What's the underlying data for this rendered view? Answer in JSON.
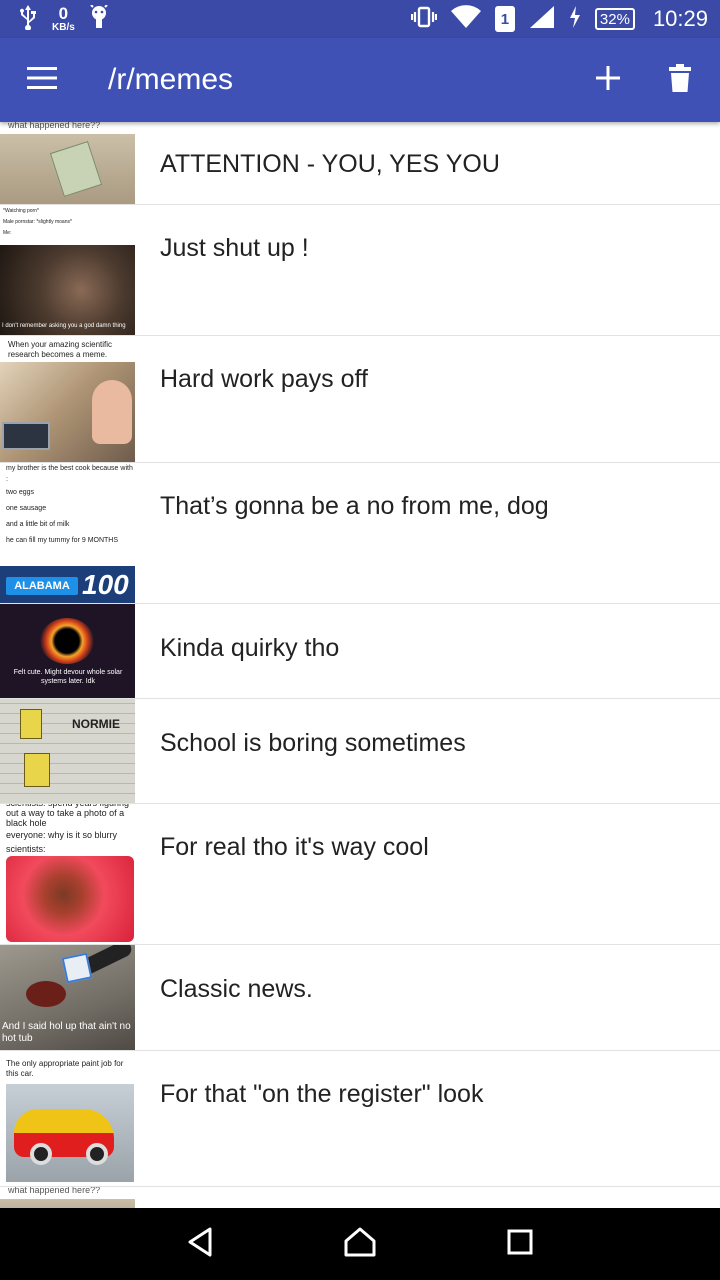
{
  "status_bar": {
    "network_speed_value": "0",
    "network_speed_unit": "KB/s",
    "sim_slot": "1",
    "battery_percent": "32%",
    "time": "10:29"
  },
  "app_bar": {
    "title": "/r/memes"
  },
  "posts": [
    {
      "title": "ATTENTION - YOU, YES YOU",
      "thumb_caption": "what happened here??",
      "thumb_colors": [
        "#c9bfae",
        "#a89a82"
      ]
    },
    {
      "title": "Just shut up !",
      "thumb_caption": "I don't remember asking you a god damn thing",
      "thumb_top_lines": [
        "*Watching porn*",
        "Male pornstar: *slightly moans*",
        "Me:"
      ],
      "thumb_colors": [
        "#5a4a3e",
        "#2a2018"
      ]
    },
    {
      "title": "Hard work pays off",
      "thumb_caption": "When your amazing scientific research becomes a meme.",
      "thumb_colors": [
        "#d8c6a8",
        "#6a5444"
      ]
    },
    {
      "title": "That’s gonna be a no from me, dog",
      "thumb_top_lines": [
        "my brother is the best cook because with :",
        "two eggs",
        "one sausage",
        "and a little bit of milk",
        "he can fill my tummy for 9 MONTHS"
      ],
      "thumb_badge": "ALABAMA",
      "thumb_score": "100",
      "thumb_colors": [
        "#ffffff",
        "#ffffff"
      ]
    },
    {
      "title": "Kinda quirky tho",
      "thumb_caption": "Felt cute. Might devour whole solar systems later. Idk",
      "thumb_colors": [
        "#2a1d33",
        "#140c1c"
      ]
    },
    {
      "title": "School is boring sometimes",
      "thumb_caption": "NORMIE",
      "thumb_colors": [
        "#d6d6cf",
        "#b9b9b0"
      ]
    },
    {
      "title": "For real tho it's way cool",
      "thumb_top_lines": [
        "scientists: spend years figuring out a way to take a photo of a black hole",
        "everyone: why is it so blurry",
        "scientists:"
      ],
      "thumb_colors": [
        "#f14a5c",
        "#c21a2a"
      ]
    },
    {
      "title": "Classic news.",
      "thumb_caption": "And I said hol up that ain't no hot tub",
      "thumb_colors": [
        "#8a857c",
        "#5f5a52"
      ]
    },
    {
      "title": "For that \"on the register\" look",
      "thumb_caption": "The only appropriate paint job for this car.",
      "thumb_colors": [
        "#ffffff",
        "#ffffff"
      ]
    },
    {
      "title": "",
      "thumb_caption": "what happened here??",
      "thumb_colors": [
        "#c9bfae",
        "#a89a82"
      ]
    }
  ],
  "colors": {
    "status_bar": "#3a4aa6",
    "app_bar": "#3f51b5",
    "nav_bar": "#000000",
    "divider": "#e2e2e2",
    "text_primary": "#222222"
  },
  "icons": {
    "app_bar": [
      "menu-icon",
      "add-icon",
      "delete-icon"
    ],
    "status_bar": [
      "usb-icon",
      "android-icon",
      "vibrate-icon",
      "wifi-icon",
      "signal-icon",
      "charging-icon"
    ],
    "nav_bar": [
      "back-icon",
      "home-icon",
      "recents-icon"
    ]
  }
}
